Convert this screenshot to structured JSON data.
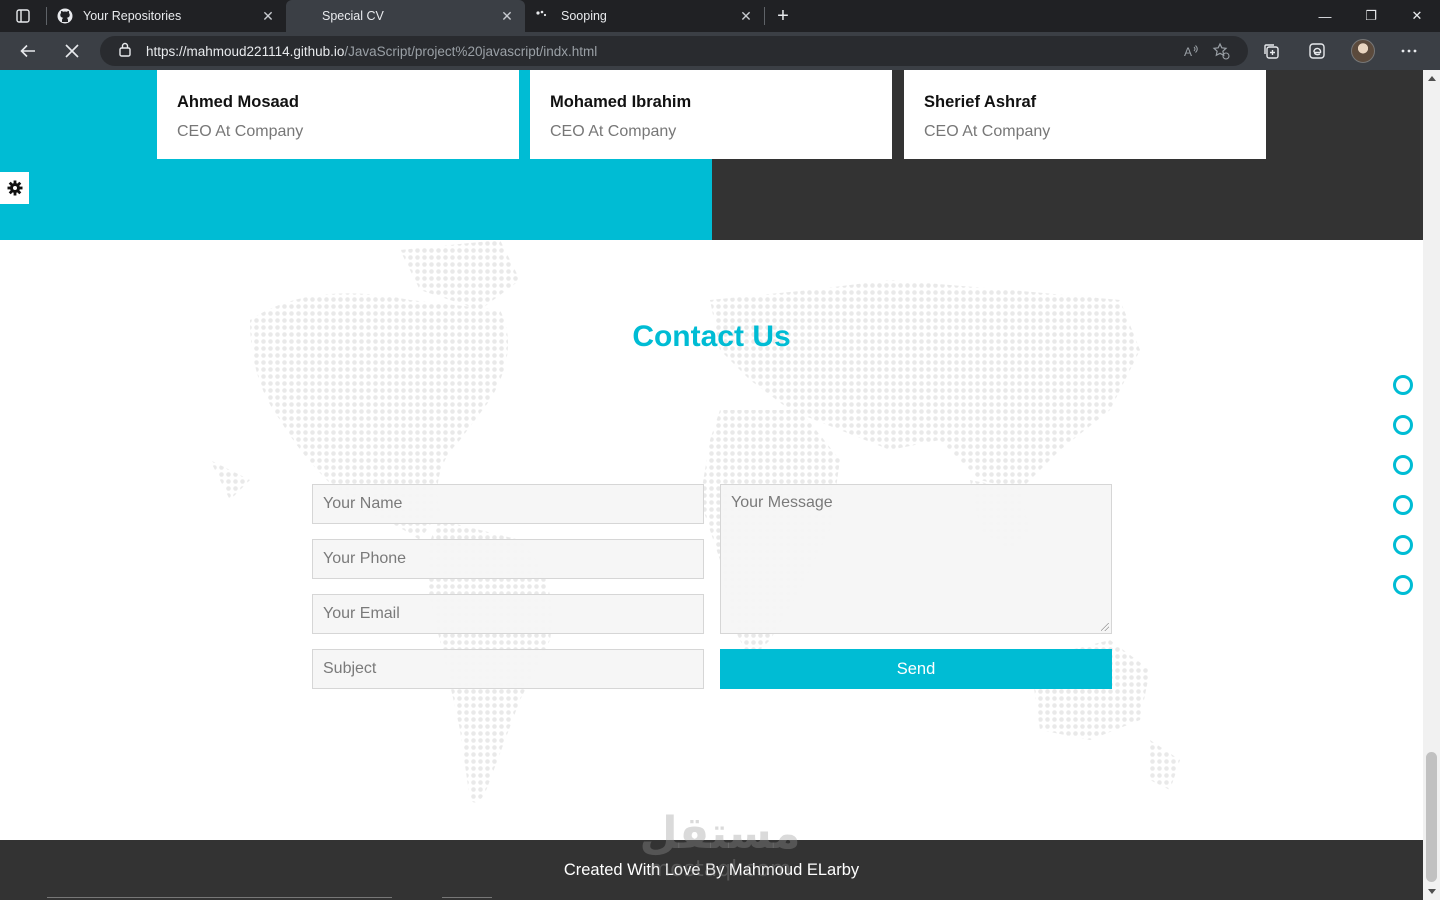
{
  "browser": {
    "tabs": [
      {
        "title": "Your Repositories",
        "icon": "github-icon",
        "active": false
      },
      {
        "title": "Special CV",
        "icon": "none",
        "active": true
      },
      {
        "title": "Sooping",
        "icon": "loading-dots-icon",
        "active": false
      }
    ],
    "url_host": "https://mahmoud221114.github.io",
    "url_path": "/JavaScript/project%20javascript/indx.html"
  },
  "testimonials": [
    {
      "name": "Ahmed Mosaad",
      "role": "CEO At Company"
    },
    {
      "name": "Mohamed Ibrahim",
      "role": "CEO At Company"
    },
    {
      "name": "Sherief Ashraf",
      "role": "CEO At Company"
    }
  ],
  "contact": {
    "title": "Contact Us",
    "name_placeholder": "Your Name",
    "phone_placeholder": "Your Phone",
    "email_placeholder": "Your Email",
    "subject_placeholder": "Subject",
    "message_placeholder": "Your Message",
    "send_label": "Send"
  },
  "footer": {
    "text": "Created With Love By Mahmoud ELarby"
  },
  "colors": {
    "accent": "#00bcd4",
    "dark": "#333333"
  },
  "watermark": "مستقل mostaql.com"
}
